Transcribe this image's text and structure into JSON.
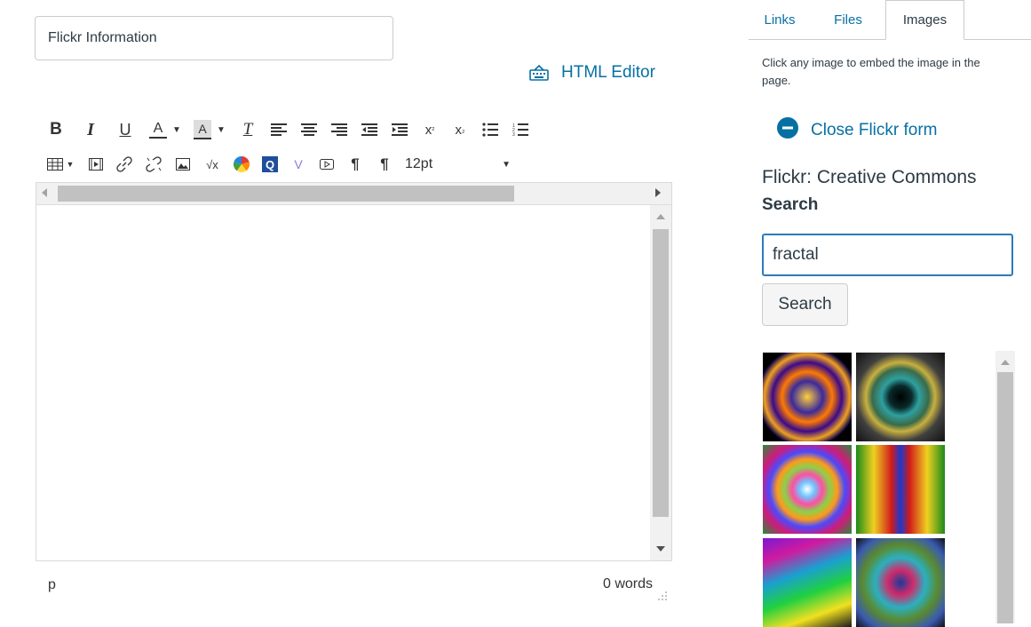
{
  "editor": {
    "title_value": "Flickr Information",
    "html_editor_label": "HTML Editor",
    "font_size": "12pt",
    "status_path": "p",
    "word_count": "0 words"
  },
  "sidebar": {
    "tabs": [
      {
        "label": "Links"
      },
      {
        "label": "Files"
      },
      {
        "label": "Images"
      }
    ],
    "help_text": "Click any image to embed the image in the page.",
    "close_flickr_label": "Close Flickr form",
    "flickr_title": "Flickr: Creative Commons",
    "search_label": "Search",
    "search_value": "fractal",
    "search_button": "Search"
  },
  "colors": {
    "link": "#0770a3",
    "text": "#2d3b45",
    "focus_border": "#2b7abc"
  }
}
